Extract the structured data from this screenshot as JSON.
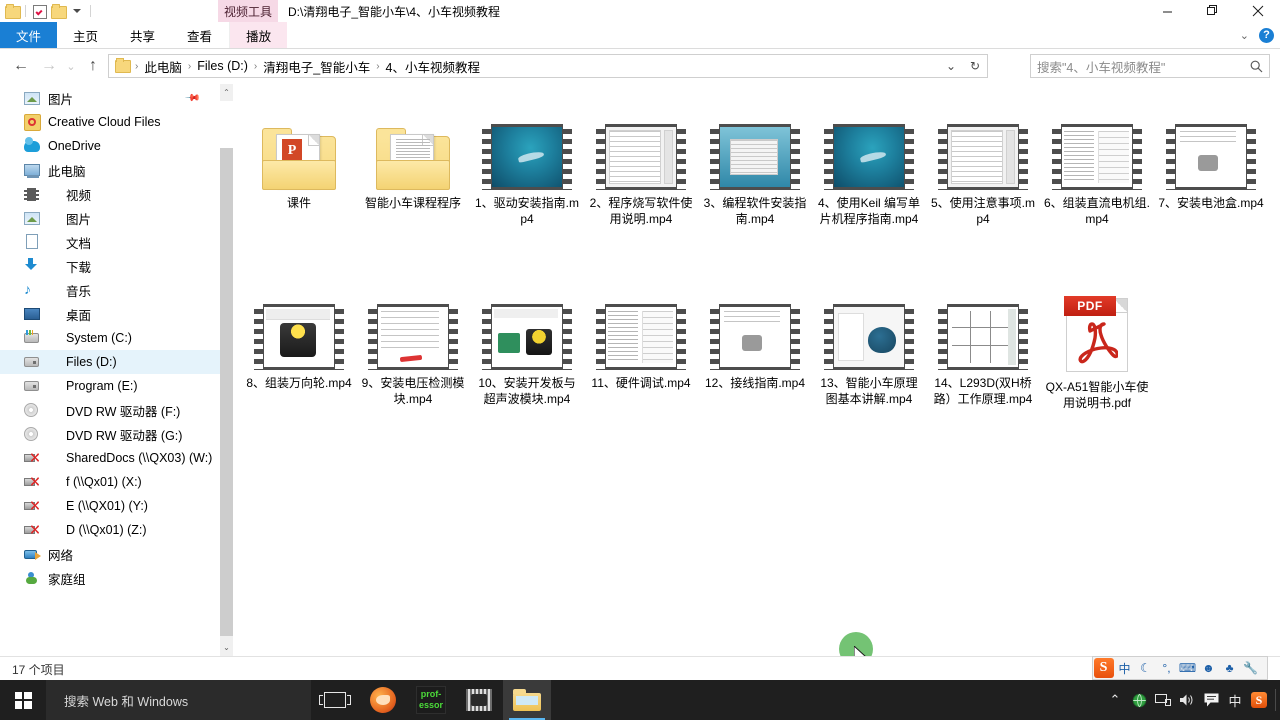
{
  "window": {
    "path_title": "D:\\清翔电子_智能小车\\4、小车视频教程",
    "contextual_tab": "视频工具",
    "minimize": "—",
    "maximize": "❐",
    "close": "✕"
  },
  "quick_access": {
    "folder_icon": "folder-icon",
    "properties_icon": "properties-checkbox-icon",
    "new_folder_icon": "new-folder-icon",
    "customize_icon": "customize-qat-chevron-icon"
  },
  "ribbon": {
    "tabs": [
      {
        "label": "文件",
        "name": "tab-file",
        "active": true
      },
      {
        "label": "主页",
        "name": "tab-home",
        "active": false
      },
      {
        "label": "共享",
        "name": "tab-share",
        "active": false
      },
      {
        "label": "查看",
        "name": "tab-view",
        "active": false
      }
    ],
    "contextual_tab": "播放",
    "expand_chevron": "⌄",
    "help": "?"
  },
  "navbar": {
    "back": "←",
    "forward": "→",
    "recent": "⌄",
    "up": "↑",
    "breadcrumbs": [
      "此电脑",
      "Files (D:)",
      "清翔电子_智能小车",
      "4、小车视频教程"
    ],
    "separator": "›",
    "dropdown": "⌄",
    "refresh": "↻"
  },
  "search": {
    "placeholder": "搜索\"4、小车视频教程\"",
    "icon": "search-icon"
  },
  "sidebar": {
    "items": [
      {
        "label": "图片",
        "icon": "picture-icon",
        "indent": 0,
        "selected": false,
        "pinned": true
      },
      {
        "label": "Creative Cloud Files",
        "icon": "creative-cloud-icon",
        "indent": 0,
        "selected": false
      },
      {
        "label": "OneDrive",
        "icon": "onedrive-icon",
        "indent": 0,
        "selected": false
      },
      {
        "label": "此电脑",
        "icon": "this-pc-icon",
        "indent": 0,
        "selected": false
      },
      {
        "label": "视频",
        "icon": "videos-icon",
        "indent": 1,
        "selected": false
      },
      {
        "label": "图片",
        "icon": "pictures-icon",
        "indent": 1,
        "selected": false
      },
      {
        "label": "文档",
        "icon": "documents-icon",
        "indent": 1,
        "selected": false
      },
      {
        "label": "下载",
        "icon": "downloads-icon",
        "indent": 1,
        "selected": false
      },
      {
        "label": "音乐",
        "icon": "music-icon",
        "indent": 1,
        "selected": false
      },
      {
        "label": "桌面",
        "icon": "desktop-icon",
        "indent": 1,
        "selected": false
      },
      {
        "label": "System (C:)",
        "icon": "system-drive-icon",
        "indent": 1,
        "selected": false
      },
      {
        "label": "Files (D:)",
        "icon": "drive-icon",
        "indent": 1,
        "selected": true
      },
      {
        "label": "Program (E:)",
        "icon": "drive-icon",
        "indent": 1,
        "selected": false
      },
      {
        "label": "DVD RW 驱动器 (F:)",
        "icon": "dvd-drive-icon",
        "indent": 1,
        "selected": false
      },
      {
        "label": "DVD RW 驱动器 (G:)",
        "icon": "dvd-drive-icon",
        "indent": 1,
        "selected": false
      },
      {
        "label": "SharedDocs (\\\\QX03) (W:)",
        "icon": "disconnected-network-drive-icon",
        "indent": 1,
        "selected": false
      },
      {
        "label": "f (\\\\Qx01) (X:)",
        "icon": "disconnected-network-drive-icon",
        "indent": 1,
        "selected": false
      },
      {
        "label": "E (\\\\QX01) (Y:)",
        "icon": "disconnected-network-drive-icon",
        "indent": 1,
        "selected": false
      },
      {
        "label": "D (\\\\Qx01) (Z:)",
        "icon": "disconnected-network-drive-icon",
        "indent": 1,
        "selected": false
      },
      {
        "label": "网络",
        "icon": "network-icon",
        "indent": 0,
        "selected": false
      },
      {
        "label": "家庭组",
        "icon": "homegroup-icon",
        "indent": 0,
        "selected": false
      }
    ],
    "scroll_up": "⌃",
    "scroll_down": "⌄"
  },
  "files": [
    {
      "name": "课件",
      "kind": "folder-ppt",
      "selected": false
    },
    {
      "name": "智能小车课程程序",
      "kind": "folder-doc",
      "selected": false
    },
    {
      "name": "1、驱动安装指南.mp4",
      "kind": "video",
      "thumb": "sea",
      "selected": false
    },
    {
      "name": "2、程序烧写软件使用说明.mp4",
      "kind": "video",
      "thumb": "doc",
      "selected": false
    },
    {
      "name": "3、编程软件安装指南.mp4",
      "kind": "video",
      "thumb": "win",
      "selected": false
    },
    {
      "name": "4、使用Keil 编写单片机程序指南.mp4",
      "kind": "video",
      "thumb": "sea",
      "selected": false
    },
    {
      "name": "5、使用注意事项.mp4",
      "kind": "video",
      "thumb": "doc",
      "selected": false
    },
    {
      "name": "6、组装直流电机组.mp4",
      "kind": "video",
      "thumb": "list",
      "selected": false
    },
    {
      "name": "7、安装电池盒.mp4",
      "kind": "video",
      "thumb": "cam",
      "selected": false
    },
    {
      "name": "8、组装万向轮.mp4",
      "kind": "video",
      "thumb": "robot",
      "selected": false
    },
    {
      "name": "9、安装电压检测模块.mp4",
      "kind": "video",
      "thumb": "red",
      "selected": false
    },
    {
      "name": "10、安装开发板与超声波模块.mp4",
      "kind": "video",
      "thumb": "mod",
      "selected": false
    },
    {
      "name": "11、硬件调试.mp4",
      "kind": "video",
      "thumb": "list",
      "selected": false
    },
    {
      "name": "12、接线指南.mp4",
      "kind": "video",
      "thumb": "cam",
      "selected": false
    },
    {
      "name": "13、智能小车原理图基本讲解.mp4",
      "kind": "video",
      "thumb": "eng",
      "selected": false
    },
    {
      "name": "14、L293D(双H桥路）工作原理.mp4",
      "kind": "video",
      "thumb": "sch",
      "selected": false
    },
    {
      "name": "QX-A51智能小车使用说明书.pdf",
      "kind": "pdf",
      "badge": "PDF",
      "selected": true
    }
  ],
  "status": {
    "item_count": "17 个项目"
  },
  "taskbar": {
    "start": "start-button",
    "search_placeholder": "搜索 Web 和 Windows",
    "apps": [
      {
        "name": "task-view-button",
        "icon": "task-view-icon",
        "active": false
      },
      {
        "name": "taskbar-firefox",
        "icon": "firefox-icon",
        "active": false
      },
      {
        "name": "taskbar-professor",
        "icon": "professor-icon",
        "label_top": "prof-",
        "label_bottom": "essor",
        "active": false
      },
      {
        "name": "taskbar-video-app",
        "icon": "video-app-icon",
        "active": false
      },
      {
        "name": "taskbar-file-explorer",
        "icon": "file-explorer-icon",
        "active": true
      }
    ],
    "tray": {
      "show_hidden": "⌃",
      "icons": [
        "network-globe-icon",
        "network-connection-icon",
        "volume-icon",
        "action-center-icon",
        "ime-chinese-icon",
        "sogou-icon"
      ],
      "ime_label": "中",
      "sogou_label": "S"
    }
  },
  "ime_bar": {
    "logo": "S",
    "mode": "中",
    "moon": "☾",
    "punct": "°,",
    "keyboard": "⌨",
    "user": "☻",
    "skin": "♣",
    "tools": "🔧"
  },
  "cursor": {
    "click_highlight_color": "#5cb85c"
  }
}
